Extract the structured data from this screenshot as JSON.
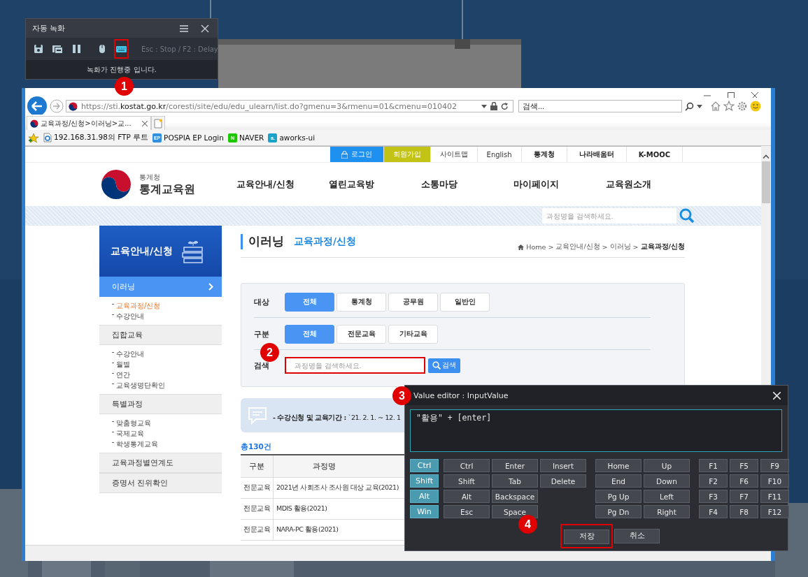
{
  "desktop": {
    "kind": "picture"
  },
  "recorder": {
    "title": "자동 녹화",
    "tools": [
      {
        "kind": "save",
        "on": false,
        "highlighted": false
      },
      {
        "kind": "capture",
        "on": false,
        "highlighted": false
      },
      {
        "kind": "pause",
        "on": false,
        "highlighted": false
      },
      {
        "kind": "mouse",
        "on": false,
        "highlighted": false
      },
      {
        "kind": "keyboard",
        "on": true,
        "highlighted": true
      }
    ],
    "hint": "Esc : Stop / F2 : Delay",
    "status": "녹화가 진행중 입니다."
  },
  "browser": {
    "url": {
      "scheme": "https://sti.",
      "domain": "kostat.go.kr",
      "path": "/coresti/site/edu/edu_ulearn/list.do?gmenu=3&rmenu=01&cmenu=010402"
    },
    "search": {
      "placeholder": "검색..."
    },
    "tabs": [
      {
        "title": "교육과정/신청>이러닝>교...",
        "selected": true
      }
    ],
    "favorites": [
      {
        "kind": "ie",
        "label": "192.168.31.98의 FTP 루트"
      },
      {
        "kind": "badge",
        "badge": "EP",
        "color": "#2f8fe0",
        "label": "POSPIA EP Login"
      },
      {
        "kind": "badge",
        "badge": "N",
        "color": "#1ec800",
        "label": "NAVER"
      },
      {
        "kind": "badge",
        "badge": "a.",
        "color": "#1aa3c8",
        "label": "aworks-ui"
      }
    ]
  },
  "site": {
    "utility": [
      {
        "label": "로그인",
        "kind": "login"
      },
      {
        "label": "회원가입",
        "kind": "join"
      },
      {
        "label": "사이트맵",
        "kind": "plain"
      },
      {
        "label": "English",
        "kind": "plain"
      },
      {
        "label": "통계청",
        "kind": "bold"
      },
      {
        "label": "나라배움터",
        "kind": "bold"
      },
      {
        "label": "K-MOOC",
        "kind": "bold"
      }
    ],
    "logo": {
      "agency": "통계청",
      "name": "통계교육원"
    },
    "nav": [
      "교육안내/신청",
      "열린교육방",
      "소통마당",
      "마이페이지",
      "교육원소개"
    ],
    "search": {
      "placeholder": "과정명을 검색하세요."
    },
    "sidebar": {
      "title": "교육안내/신청",
      "sections": [
        {
          "label": "이러닝",
          "selected": true,
          "children": [
            {
              "label": "교육과정/신청",
              "selected": true
            },
            {
              "label": "수강안내",
              "selected": false
            }
          ]
        },
        {
          "label": "집합교육",
          "selected": false,
          "children": [
            {
              "label": "수강안내",
              "selected": false
            },
            {
              "label": "월별",
              "selected": false
            },
            {
              "label": "연간",
              "selected": false
            },
            {
              "label": "교육생명단확인",
              "selected": false
            }
          ]
        },
        {
          "label": "특별과정",
          "selected": false,
          "children": [
            {
              "label": "맞춤형교육",
              "selected": false
            },
            {
              "label": "국제교육",
              "selected": false
            },
            {
              "label": "학생통계교육",
              "selected": false
            }
          ]
        },
        {
          "label": "교육과정별연계도",
          "selected": false
        },
        {
          "label": "증명서 진위확인",
          "selected": false
        }
      ]
    },
    "page_title": "이러닝",
    "page_subtitle": "교육과정/신청",
    "breadcrumb": {
      "separator": ">",
      "items": [
        "Home",
        "교육안내/신청",
        "이러닝",
        "교육과정/신청"
      ]
    },
    "filters": [
      {
        "label": "대상",
        "options": [
          {
            "label": "전체",
            "selected": true
          },
          {
            "label": "통계청",
            "selected": false
          },
          {
            "label": "공무원",
            "selected": false
          },
          {
            "label": "일반인",
            "selected": false
          }
        ]
      },
      {
        "label": "구분",
        "options": [
          {
            "label": "전체",
            "selected": true
          },
          {
            "label": "전문교육",
            "selected": false
          },
          {
            "label": "기타교육",
            "selected": false
          }
        ]
      }
    ],
    "search_row": {
      "label": "검색",
      "placeholder": "과정명을 검색하세요.",
      "highlighted": true,
      "button": "검색"
    },
    "notice": "**- 수강신청 및 교육기간 :** `21. 2. 1. ~ 12. 1",
    "total": "총130건",
    "table": {
      "columns": [
        "구분",
        "과정명"
      ],
      "rows": [
        [
          "전문교육",
          "2021년 사회조사 조사원 대상 교육(2021)"
        ],
        [
          "전문교육",
          "MDIS 활용(2021)"
        ],
        [
          "전문교육",
          "NARA-PC 활용(2021)"
        ]
      ]
    }
  },
  "editor": {
    "title": "Value editor : InputValue",
    "value": "\"활용\" + [enter]",
    "modifiers": [
      "Ctrl",
      "Shift",
      "Alt",
      "Win"
    ],
    "key_groups": [
      [
        [
          "Ctrl",
          "Shift",
          "Alt",
          "Esc"
        ],
        [
          "Enter",
          "Tab",
          "Backspace",
          "Space"
        ],
        [
          "Insert",
          "Delete"
        ]
      ],
      [
        [
          "Home",
          "End",
          "Pg Up",
          "Pg Dn"
        ],
        [
          "Up",
          "Down",
          "Left",
          "Right"
        ]
      ],
      [
        [
          "F1",
          "F2",
          "F3",
          "F4"
        ],
        [
          "F5",
          "F6",
          "F7",
          "F8"
        ],
        [
          "F9",
          "F10",
          "F11",
          "F12"
        ]
      ]
    ],
    "buttons": [
      {
        "label": "저장",
        "highlighted": true
      },
      {
        "label": "취소",
        "highlighted": false
      }
    ]
  },
  "annotations": [
    "1",
    "2",
    "3",
    "4"
  ]
}
